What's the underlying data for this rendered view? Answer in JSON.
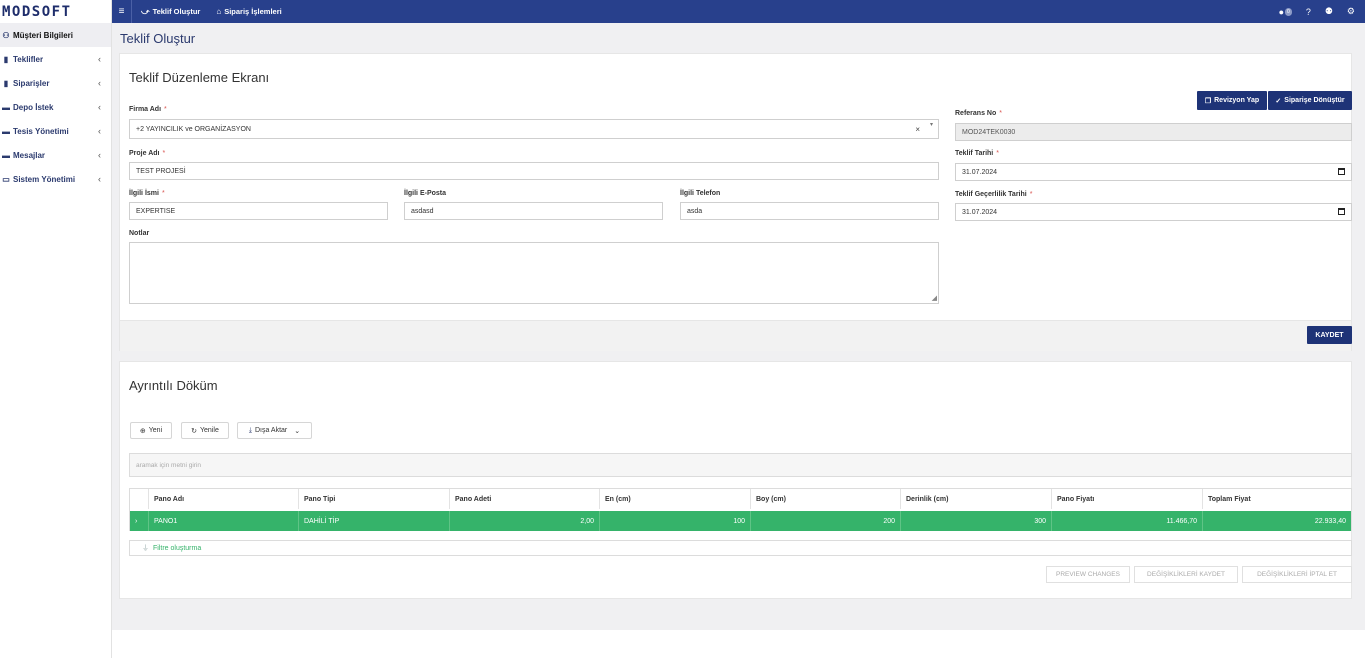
{
  "app": {
    "logo": "MODSOFT"
  },
  "sidebar": {
    "items": [
      {
        "label": "Müşteri Bilgileri",
        "icon": "users-cog-icon",
        "glyph": "⚇"
      },
      {
        "label": "Teklifler",
        "icon": "file-icon",
        "glyph": "▮"
      },
      {
        "label": "Siparişler",
        "icon": "cart-icon",
        "glyph": "▮"
      },
      {
        "label": "Depo İstek",
        "icon": "warehouse-icon",
        "glyph": "▬"
      },
      {
        "label": "Tesis Yönetimi",
        "icon": "industry-icon",
        "glyph": "▬"
      },
      {
        "label": "Mesajlar",
        "icon": "messages-icon",
        "glyph": "▬"
      },
      {
        "label": "Sistem Yönetimi",
        "icon": "monitor-icon",
        "glyph": "▭"
      }
    ]
  },
  "topbar": {
    "nav": [
      {
        "label": "Teklif Oluştur",
        "icon": "handshake-icon"
      },
      {
        "label": "Sipariş İşlemleri",
        "icon": "basket-icon"
      }
    ],
    "message_count": "0"
  },
  "page": {
    "title": "Teklif Oluştur"
  },
  "form": {
    "title": "Teklif Düzenleme Ekranı",
    "revision_button": "Revizyon Yap",
    "convert_button": "Siparişe Dönüştür",
    "firma_label": "Firma Adı",
    "firma_value": "+2 YAYINCILIK ve ORGANİZASYON",
    "clear_glyph": "×",
    "proje_label": "Proje Adı",
    "proje_value": "TEST PROJESİ",
    "ilgili_label": "İlgili İsmi",
    "ilgili_value": "EXPERTISE",
    "eposta_label": "İlgili E-Posta",
    "eposta_value": "asdasd",
    "telefon_label": "İlgili Telefon",
    "telefon_value": "asda",
    "notlar_label": "Notlar",
    "referans_label": "Referans No",
    "referans_value": "MOD24TEK0030",
    "tarih_label": "Teklif Tarihi",
    "tarih_value": "31.07.2024",
    "gecerlilik_label": "Teklif Geçerlilik Tarihi",
    "gecerlilik_value": "31.07.2024",
    "save_button": "KAYDET"
  },
  "detail": {
    "title": "Ayrıntılı Döküm",
    "new_button": "Yeni",
    "refresh_button": "Yenile",
    "export_button": "Dışa Aktar",
    "search_placeholder": "aramak için metni girin",
    "columns": [
      "Pano Adı",
      "Pano Tipi",
      "Pano Adeti",
      "En (cm)",
      "Boy (cm)",
      "Derinlik (cm)",
      "Pano Fiyatı",
      "Toplam Fiyat"
    ],
    "rows": [
      [
        "PANO1",
        "DAHİLİ TİP",
        "2,00",
        "100",
        "200",
        "300",
        "11.466,70",
        "22.933,40"
      ]
    ],
    "filter_label": "Filtre oluşturma",
    "preview_button": "PREVIEW CHANGES",
    "save_changes_button": "DEĞİŞİKLİKLERİ KAYDET",
    "cancel_changes_button": "DEĞİŞİKLİKLERİ İPTAL ET"
  }
}
